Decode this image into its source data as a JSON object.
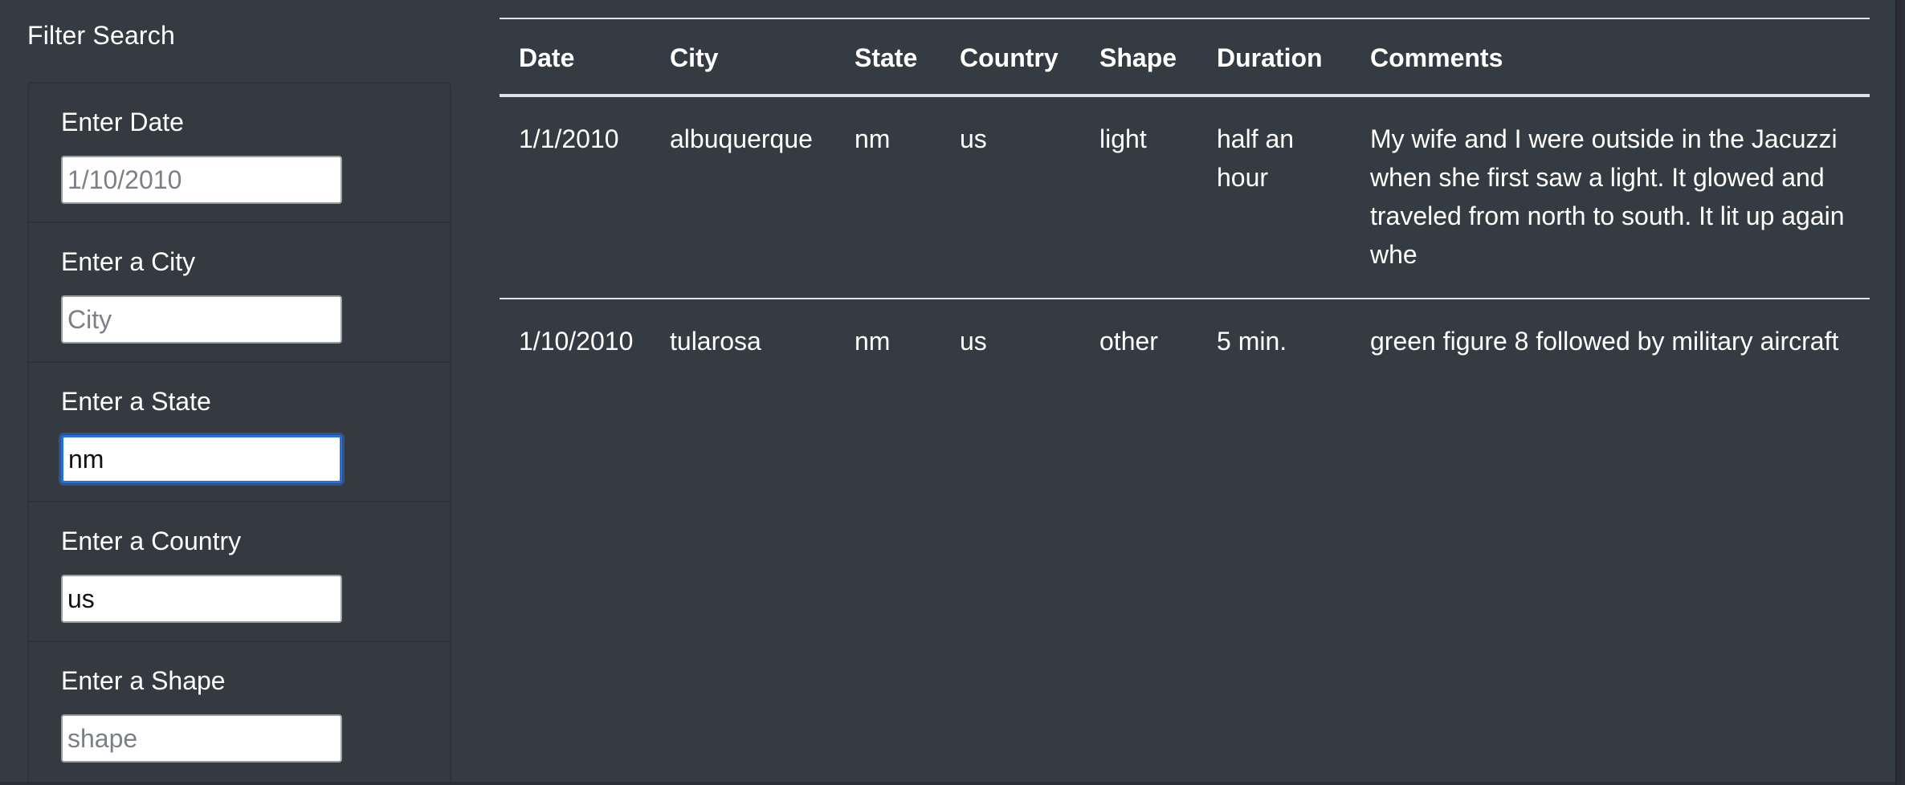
{
  "filter": {
    "title": "Filter Search",
    "fields": [
      {
        "label": "Enter Date",
        "placeholder": "1/10/2010",
        "value": ""
      },
      {
        "label": "Enter a City",
        "placeholder": "City",
        "value": ""
      },
      {
        "label": "Enter a State",
        "placeholder": "",
        "value": "nm"
      },
      {
        "label": "Enter a Country",
        "placeholder": "",
        "value": "us"
      },
      {
        "label": "Enter a Shape",
        "placeholder": "shape",
        "value": ""
      }
    ]
  },
  "table": {
    "columns": [
      "Date",
      "City",
      "State",
      "Country",
      "Shape",
      "Duration",
      "Comments"
    ],
    "rows": [
      {
        "date": "1/1/2010",
        "city": "albuquerque",
        "state": "nm",
        "country": "us",
        "shape": "light",
        "duration": "half an hour",
        "comments": "My wife and I were outside in the Jacuzzi when she first saw a light. It glowed and traveled from north to south. It lit up again whe"
      },
      {
        "date": "1/10/2010",
        "city": "tularosa",
        "state": "nm",
        "country": "us",
        "shape": "other",
        "duration": "5 min.",
        "comments": "green figure 8 followed by military aircraft"
      }
    ]
  },
  "colors": {
    "background": "#353b43",
    "focus_ring": "#1f6feb",
    "table_rule": "#dee2e6"
  }
}
